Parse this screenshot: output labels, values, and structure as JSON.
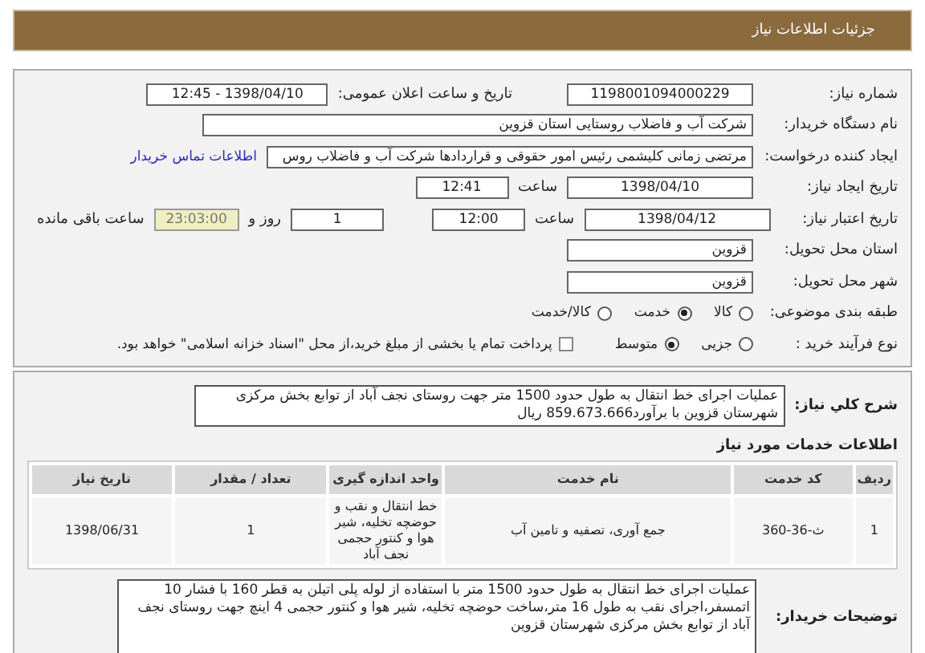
{
  "header": {
    "title": "جزئیات اطلاعات نیاز"
  },
  "need_number": {
    "label": "شماره نیاز:",
    "value": "1198001094000229"
  },
  "announce": {
    "label": "تاریخ و ساعت اعلان عمومی:",
    "value": "1398/04/10 - 12:45"
  },
  "buyer_org": {
    "label": "نام دستگاه خریدار:",
    "value": "شرکت آب و فاضلاب روستایی استان قزوین"
  },
  "requester": {
    "label": "ایجاد کننده درخواست:",
    "value": "مرتضی زمانی کلیشمی رئیس امور حقوقی و قراردادها شرکت آب و فاضلاب روس",
    "link": "اطلاعات تماس خریدار"
  },
  "created": {
    "label": "تاریخ ایجاد نیاز:",
    "date": "1398/04/10",
    "time_label": "ساعت",
    "time": "12:41"
  },
  "validity": {
    "label": "تاریخ اعتبار نیاز:",
    "date": "1398/04/12",
    "time_label": "ساعت",
    "time": "12:00",
    "days": "1",
    "days_label": "روز و",
    "remaining": "23:03:00",
    "remaining_label": "ساعت باقی مانده"
  },
  "province": {
    "label": "استان محل تحویل:",
    "value": "قزوین"
  },
  "city": {
    "label": "شهر محل تحویل:",
    "value": "قزوین"
  },
  "category": {
    "label": "طبقه بندی موضوعی:",
    "options": [
      {
        "label": "کالا",
        "selected": false
      },
      {
        "label": "خدمت",
        "selected": true
      },
      {
        "label": "کالا/خدمت",
        "selected": false
      }
    ]
  },
  "purchase": {
    "label": "نوع فرآیند خرید :",
    "options": [
      {
        "label": "جزیی",
        "selected": false
      },
      {
        "label": "متوسط",
        "selected": true
      }
    ],
    "checkbox": {
      "label": "پرداخت تمام یا بخشی از مبلغ خرید،از محل \"اسناد خزانه اسلامی\" خواهد بود.",
      "checked": false
    }
  },
  "description": {
    "label": "شرح کلي نياز:",
    "text": "عملیات اجرای خط انتقال به طول حدود 1500 متر جهت روستای نجف آباد از توابع بخش مرکزی شهرستان قزوین با برآورد859.673.666  ریال"
  },
  "services": {
    "title": "اطلاعات خدمات مورد نیاز",
    "columns": [
      "ردیف",
      "کد خدمت",
      "نام خدمت",
      "واحد اندازه گیری",
      "تعداد / مقدار",
      "تاریخ نیاز"
    ],
    "rows": [
      [
        "1",
        "ث-36-360",
        "جمع آوری، تصفیه و تامین آب",
        "خط انتقال و نقب و حوضچه تخلیه، شیر هوا و کنتور حجمی نجف آباد",
        "1",
        "1398/06/31"
      ]
    ]
  },
  "buyer_notes": {
    "label": "توضیحات خریدار:",
    "text": "عملیات اجرای خط انتقال به طول حدود 1500 متر با استفاده از لوله پلی اتیلن به قطر 160 با فشار 10 اتمسفر،اجرای نقب به طول 16 متر،ساخت حوضچه تخلیه، شیر هوا و کنتور حجمی 4 اینچ جهت روستای نجف آباد از توابع بخش مرکزی شهرستان قزوین"
  }
}
